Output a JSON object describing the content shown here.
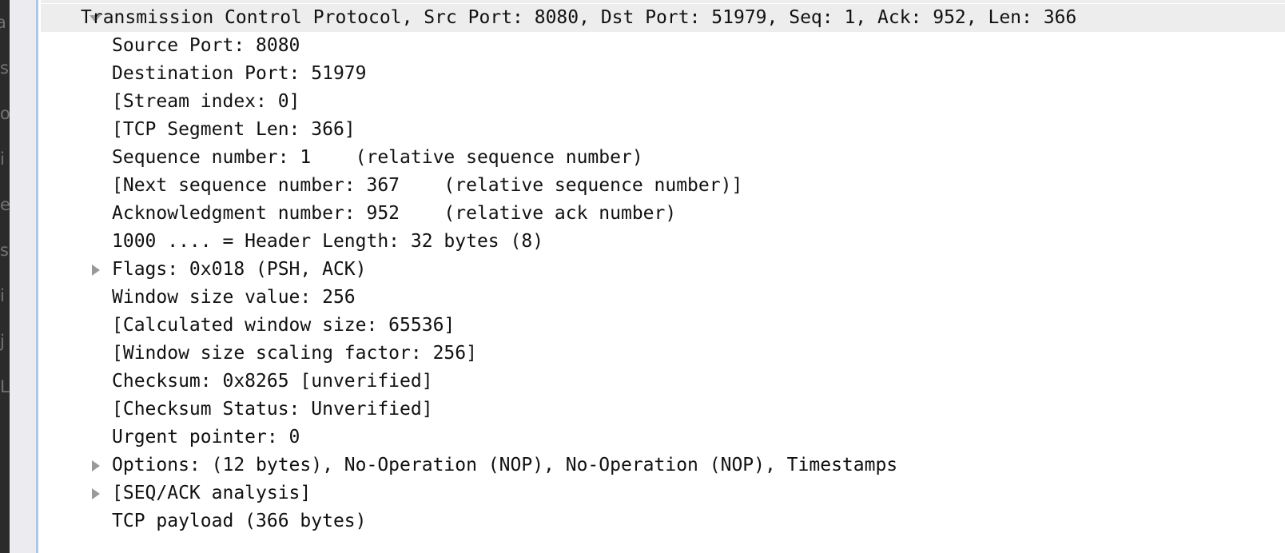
{
  "app": {
    "pane_name": "packet-details",
    "background_color": "#ffffff",
    "selection_color": "#ededed",
    "rule_color": "#aec6e8",
    "gutter_color": "#ececf0",
    "dock_color": "#2b2b2b",
    "twisty_color": "#999999"
  },
  "dock": {
    "glyph_fragments": "a\ns\no\ni\ne\ns\ni\nj\nL"
  },
  "tree": {
    "rows": [
      {
        "label": "Transmission Control Protocol, Src Port: 8080, Dst Port: 51979, Seq: 1, Ack: 952, Len: 366",
        "depth": 0,
        "twisty": "expanded",
        "selected": true,
        "name": "tcp-protocol-node"
      },
      {
        "label": "Source Port: 8080",
        "depth": 1,
        "twisty": "none",
        "selected": false,
        "name": "source-port-row"
      },
      {
        "label": "Destination Port: 51979",
        "depth": 1,
        "twisty": "none",
        "selected": false,
        "name": "destination-port-row"
      },
      {
        "label": "[Stream index: 0]",
        "depth": 1,
        "twisty": "none",
        "selected": false,
        "name": "stream-index-row"
      },
      {
        "label": "[TCP Segment Len: 366]",
        "depth": 1,
        "twisty": "none",
        "selected": false,
        "name": "tcp-segment-len-row"
      },
      {
        "label": "Sequence number: 1    (relative sequence number)",
        "depth": 1,
        "twisty": "none",
        "selected": false,
        "name": "sequence-number-row"
      },
      {
        "label": "[Next sequence number: 367    (relative sequence number)]",
        "depth": 1,
        "twisty": "none",
        "selected": false,
        "name": "next-sequence-number-row"
      },
      {
        "label": "Acknowledgment number: 952    (relative ack number)",
        "depth": 1,
        "twisty": "none",
        "selected": false,
        "name": "acknowledgment-number-row"
      },
      {
        "label": "1000 .... = Header Length: 32 bytes (8)",
        "depth": 1,
        "twisty": "none",
        "selected": false,
        "name": "header-length-row"
      },
      {
        "label": "Flags: 0x018 (PSH, ACK)",
        "depth": 1,
        "twisty": "collapsed",
        "selected": false,
        "name": "flags-row"
      },
      {
        "label": "Window size value: 256",
        "depth": 1,
        "twisty": "none",
        "selected": false,
        "name": "window-size-value-row"
      },
      {
        "label": "[Calculated window size: 65536]",
        "depth": 1,
        "twisty": "none",
        "selected": false,
        "name": "calculated-window-size-row"
      },
      {
        "label": "[Window size scaling factor: 256]",
        "depth": 1,
        "twisty": "none",
        "selected": false,
        "name": "window-scaling-factor-row"
      },
      {
        "label": "Checksum: 0x8265 [unverified]",
        "depth": 1,
        "twisty": "none",
        "selected": false,
        "name": "checksum-row"
      },
      {
        "label": "[Checksum Status: Unverified]",
        "depth": 1,
        "twisty": "none",
        "selected": false,
        "name": "checksum-status-row"
      },
      {
        "label": "Urgent pointer: 0",
        "depth": 1,
        "twisty": "none",
        "selected": false,
        "name": "urgent-pointer-row"
      },
      {
        "label": "Options: (12 bytes), No-Operation (NOP), No-Operation (NOP), Timestamps",
        "depth": 1,
        "twisty": "collapsed",
        "selected": false,
        "name": "options-row"
      },
      {
        "label": "[SEQ/ACK analysis]",
        "depth": 1,
        "twisty": "collapsed",
        "selected": false,
        "name": "seq-ack-analysis-row"
      },
      {
        "label": "TCP payload (366 bytes)",
        "depth": 1,
        "twisty": "none",
        "selected": false,
        "name": "tcp-payload-row"
      }
    ]
  }
}
